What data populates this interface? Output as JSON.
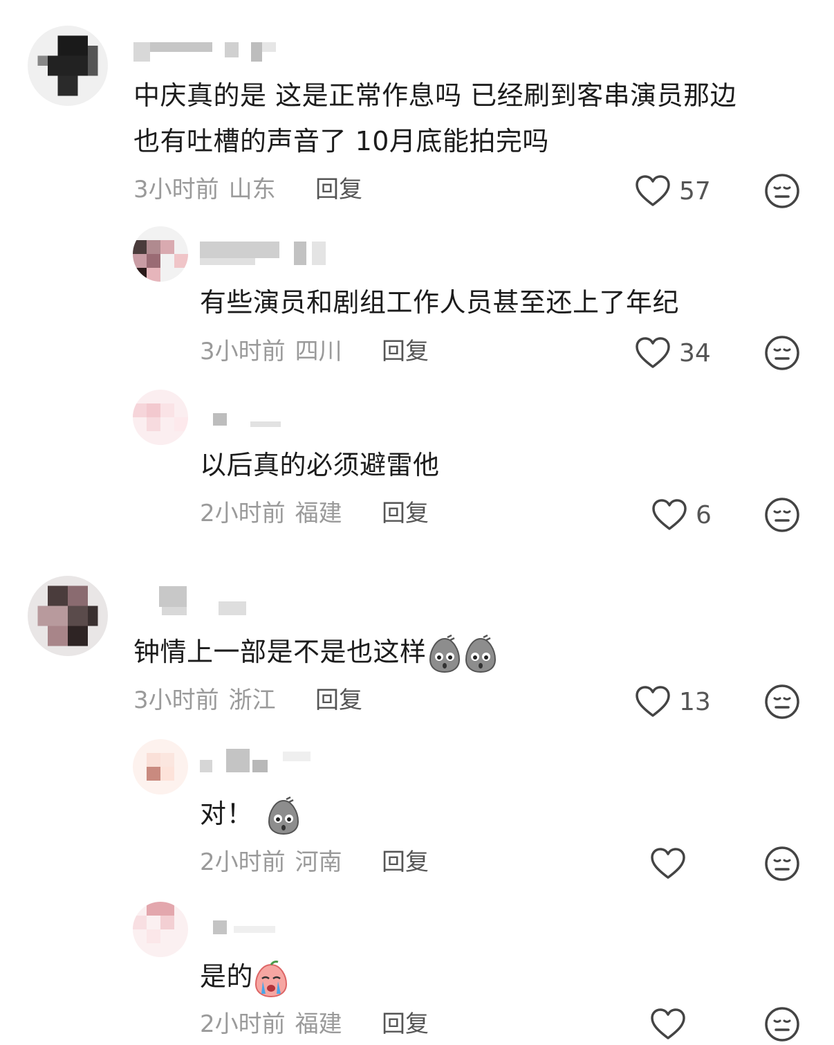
{
  "comments": [
    {
      "text_lines": [
        "中庆真的是 这是正常作息吗  已经刷到客串演员那边",
        "也有吐槽的声音了  10月底能拍完吗"
      ],
      "time": "3小时前",
      "region": "山东",
      "reply": "回复",
      "likes": "57"
    },
    {
      "text_lines": [
        "有些演员和剧组工作人员甚至还上了年纪"
      ],
      "time": "3小时前",
      "region": "四川",
      "reply": "回复",
      "likes": "34"
    },
    {
      "text_lines": [
        "以后真的必须避雷他"
      ],
      "time": "2小时前",
      "region": "福建",
      "reply": "回复",
      "likes": "6"
    },
    {
      "text_lines": [
        "钟情上一部是不是也这样"
      ],
      "time": "3小时前",
      "region": "浙江",
      "reply": "回复",
      "likes": "13"
    },
    {
      "text_lines": [
        "对！"
      ],
      "time": "2小时前",
      "region": "河南",
      "reply": "回复",
      "likes": ""
    },
    {
      "text_lines": [
        "是的"
      ],
      "time": "2小时前",
      "region": "福建",
      "reply": "回复",
      "likes": ""
    }
  ],
  "icons": {
    "like": "heart-outline-icon",
    "dislike": "neutral-face-icon",
    "emoji_gray": "gray-blob-shocked-emoji",
    "emoji_cry": "pink-crying-emoji"
  },
  "colors": {
    "text": "#1c1c1c",
    "meta": "#9a9a9a",
    "reply": "#555555",
    "icon": "#444444"
  }
}
